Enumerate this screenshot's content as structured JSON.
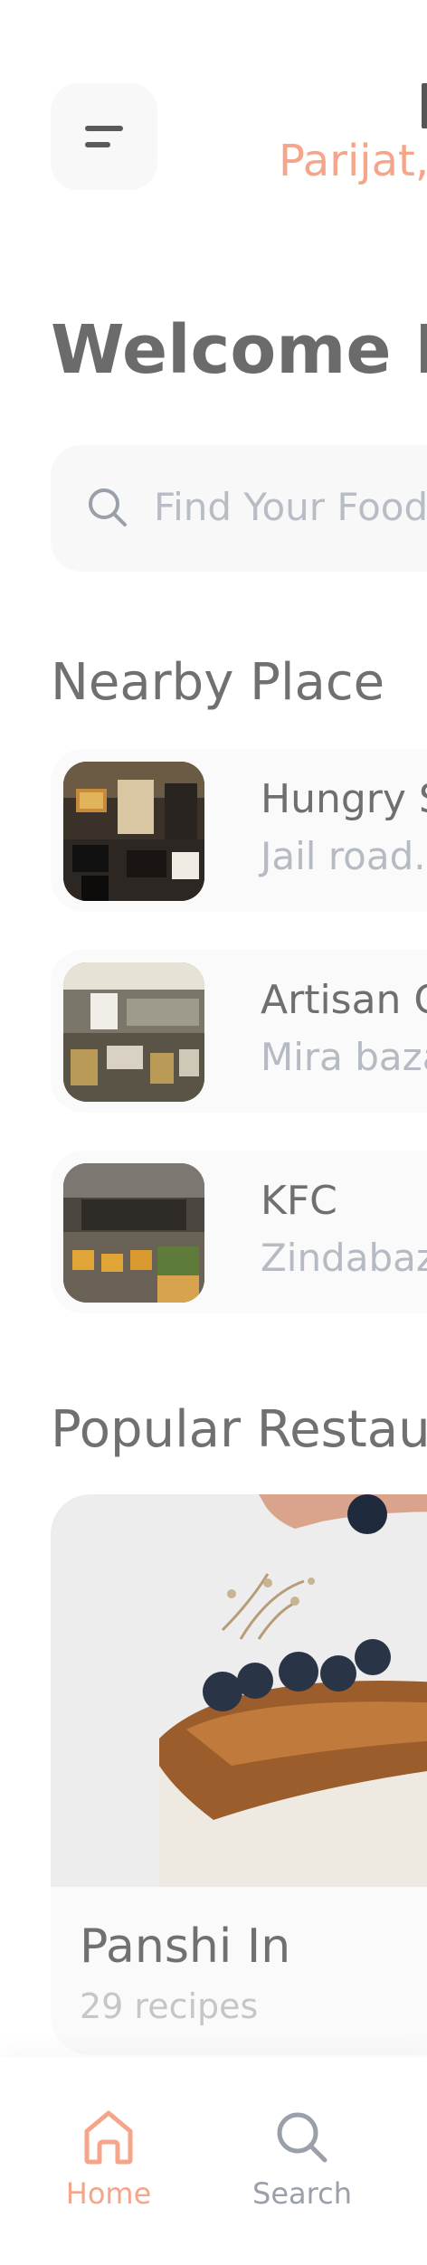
{
  "header": {
    "location_top": "",
    "location_text": "Parijat,"
  },
  "welcome": {
    "title": "Welcome F"
  },
  "search": {
    "placeholder": "Find Your Food"
  },
  "nearby": {
    "title": "Nearby Place",
    "items": [
      {
        "name": "Hungry S",
        "address": "Jail road."
      },
      {
        "name": "Artisan C",
        "address": "Mira baza"
      },
      {
        "name": "KFC",
        "address": "Zindabaz"
      }
    ]
  },
  "popular": {
    "title": "Popular Restau",
    "cards": [
      {
        "name": "Panshi In",
        "recipes": "29 recipes"
      }
    ]
  },
  "nav": {
    "items": [
      {
        "label": "Home",
        "icon": "home-icon",
        "active": true
      },
      {
        "label": "Search",
        "icon": "search-icon",
        "active": false
      }
    ]
  },
  "colors": {
    "accent": "#f4a58a",
    "text_dark": "#6b6b6b",
    "text_muted": "#b5bac3",
    "card_bg": "#fafafa"
  }
}
